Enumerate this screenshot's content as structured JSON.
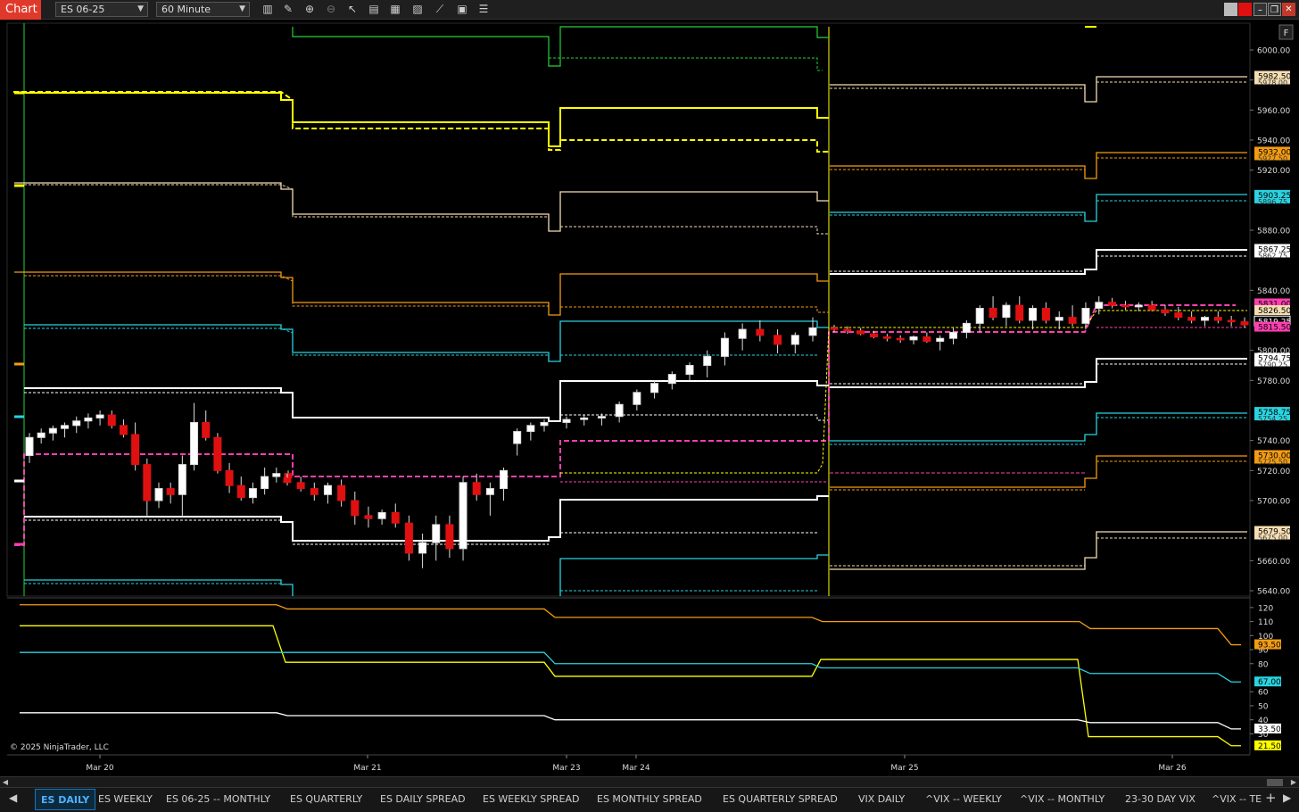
{
  "window": {
    "app_tab": "Chart",
    "instrument": "ES 06-25",
    "interval": "60 Minute",
    "toolbar_icons": [
      "bar-type-icon",
      "pencil-icon",
      "zoom-in-icon",
      "zoom-out-icon",
      "pointer-icon",
      "data-box-icon",
      "templates-icon",
      "indicators-icon",
      "strategies-icon",
      "properties-icon",
      "list-icon"
    ],
    "window_controls": [
      "theme-icon",
      "link-icon",
      "minimize-icon",
      "maximize-icon",
      "close-icon"
    ],
    "f_button": "F"
  },
  "price_axis": {
    "ticks": [
      "6000.00",
      "5980.00",
      "5960.00",
      "5940.00",
      "5920.00",
      "5880.00",
      "5840.00",
      "5800.00",
      "5780.00",
      "5740.00",
      "5720.00",
      "5700.00",
      "5660.00",
      "5640.00"
    ],
    "markers": [
      {
        "label": "5982.50",
        "sub": "5978.00",
        "color": "#f5deb3"
      },
      {
        "label": "5932.00",
        "sub": "5927.50",
        "color": "#f39c12"
      },
      {
        "label": "5903.25",
        "sub": "5896.75",
        "color": "#29d3e0"
      },
      {
        "label": "5867.25",
        "sub": "5862.75",
        "color": "#ffffff"
      },
      {
        "label": "5831.00",
        "sub": "",
        "color": "#ff3fb1"
      },
      {
        "label": "5826.50",
        "sub": "",
        "color": "#f5deb3"
      },
      {
        "label": "5819.25",
        "sub": "",
        "color": "#000000"
      },
      {
        "label": "5815.50",
        "sub": "",
        "color": "#ff3fb1"
      },
      {
        "label": "5794.75",
        "sub": "5790.25",
        "color": "#ffffff"
      },
      {
        "label": "5758.75",
        "sub": "5754.25",
        "color": "#29d3e0"
      },
      {
        "label": "5730.00",
        "sub": "5725.50",
        "color": "#f39c12"
      },
      {
        "label": "5679.50",
        "sub": "5675.00",
        "color": "#f5deb3"
      }
    ]
  },
  "indicator_axis": {
    "ticks": [
      "120",
      "110",
      "100",
      "90",
      "80",
      "60",
      "50",
      "40",
      "30"
    ],
    "markers": [
      {
        "label": "93.50",
        "color": "#f39c12"
      },
      {
        "label": "67.00",
        "color": "#29d3e0"
      },
      {
        "label": "33.50",
        "color": "#ffffff"
      },
      {
        "label": "21.50",
        "color": "#ffff00"
      }
    ]
  },
  "time_axis": [
    "Mar 20",
    "Mar 21",
    "Mar 23",
    "Mar 24",
    "Mar 25",
    "Mar 26"
  ],
  "copyright": "© 2025 NinjaTrader, LLC",
  "tabs": [
    "ES DAILY",
    "ES WEEKLY",
    "ES 06-25 -- MONTHLY",
    "ES QUARTERLY",
    "ES DAILY SPREAD",
    "ES WEEKLY SPREAD",
    "ES MONTHLY SPREAD",
    "ES QUARTERLY SPREAD",
    "VIX DAILY",
    "^VIX -- WEEKLY",
    "^VIX -- MONTHLY",
    "23-30 DAY VIX",
    "^VIX -- TER"
  ],
  "active_tab": "ES DAILY",
  "colors": {
    "green": "#22d33a",
    "yellow": "#ffff00",
    "cream": "#f5deb3",
    "orange": "#f39c12",
    "cyan": "#29d3e0",
    "white": "#ffffff",
    "pink": "#ff3fb1",
    "bull": "#ffffff",
    "bear": "#e01010"
  },
  "chart_data": {
    "type": "candlestick",
    "interval": "60 Minute",
    "x": [
      "Mar 20",
      "Mar 21",
      "Mar 23",
      "Mar 24",
      "Mar 25",
      "Mar 26"
    ],
    "ylim": [
      5632,
      6020
    ],
    "indicator_ylim": [
      15,
      125
    ],
    "candles_approx": [
      [
        5730,
        5745,
        5725,
        5742
      ],
      [
        5742,
        5748,
        5738,
        5745
      ],
      [
        5745,
        5750,
        5740,
        5748
      ],
      [
        5748,
        5752,
        5742,
        5750
      ],
      [
        5750,
        5756,
        5745,
        5753
      ],
      [
        5753,
        5758,
        5748,
        5755
      ],
      [
        5755,
        5760,
        5750,
        5757
      ],
      [
        5757,
        5760,
        5748,
        5750
      ],
      [
        5750,
        5754,
        5742,
        5744
      ],
      [
        5744,
        5752,
        5720,
        5724
      ],
      [
        5724,
        5728,
        5690,
        5700
      ],
      [
        5700,
        5712,
        5695,
        5708
      ],
      [
        5708,
        5712,
        5698,
        5704
      ],
      [
        5704,
        5730,
        5690,
        5724
      ],
      [
        5724,
        5765,
        5720,
        5752
      ],
      [
        5752,
        5760,
        5740,
        5742
      ],
      [
        5742,
        5745,
        5718,
        5720
      ],
      [
        5720,
        5725,
        5705,
        5710
      ],
      [
        5710,
        5716,
        5700,
        5702
      ],
      [
        5702,
        5712,
        5698,
        5708
      ],
      [
        5708,
        5722,
        5704,
        5716
      ],
      [
        5716,
        5722,
        5712,
        5718
      ],
      [
        5718,
        5720,
        5712,
        5715
      ],
      [
        5715,
        5718,
        5710,
        5712
      ],
      [
        5712,
        5716,
        5706,
        5708
      ],
      [
        5708,
        5712,
        5700,
        5704
      ],
      [
        5704,
        5712,
        5698,
        5710
      ],
      [
        5710,
        5714,
        5696,
        5700
      ],
      [
        5700,
        5706,
        5684,
        5690
      ],
      [
        5690,
        5696,
        5682,
        5688
      ],
      [
        5688,
        5694,
        5684,
        5692
      ],
      [
        5692,
        5698,
        5682,
        5685
      ],
      [
        5685,
        5690,
        5660,
        5665
      ],
      [
        5665,
        5678,
        5655,
        5672
      ],
      [
        5672,
        5690,
        5660,
        5684
      ],
      [
        5684,
        5690,
        5662,
        5668
      ],
      [
        5668,
        5716,
        5660,
        5712
      ],
      [
        5712,
        5718,
        5700,
        5704
      ],
      [
        5704,
        5712,
        5690,
        5708
      ],
      [
        5708,
        5722,
        5700,
        5720
      ],
      [
        5738,
        5748,
        5730,
        5746
      ],
      [
        5746,
        5752,
        5740,
        5750
      ],
      [
        5750,
        5754,
        5746,
        5752
      ],
      [
        5752,
        5756,
        5748,
        5754
      ],
      [
        5754,
        5757,
        5750,
        5755
      ],
      [
        5755,
        5758,
        5750,
        5756
      ],
      [
        5756,
        5766,
        5752,
        5764
      ],
      [
        5764,
        5774,
        5760,
        5772
      ],
      [
        5772,
        5780,
        5768,
        5778
      ],
      [
        5778,
        5786,
        5774,
        5784
      ],
      [
        5784,
        5792,
        5780,
        5790
      ],
      [
        5790,
        5800,
        5782,
        5796
      ],
      [
        5796,
        5812,
        5790,
        5808
      ],
      [
        5808,
        5818,
        5800,
        5814
      ],
      [
        5814,
        5820,
        5806,
        5810
      ],
      [
        5810,
        5814,
        5798,
        5804
      ],
      [
        5804,
        5812,
        5798,
        5810
      ],
      [
        5810,
        5822,
        5806,
        5815
      ]
    ]
  }
}
